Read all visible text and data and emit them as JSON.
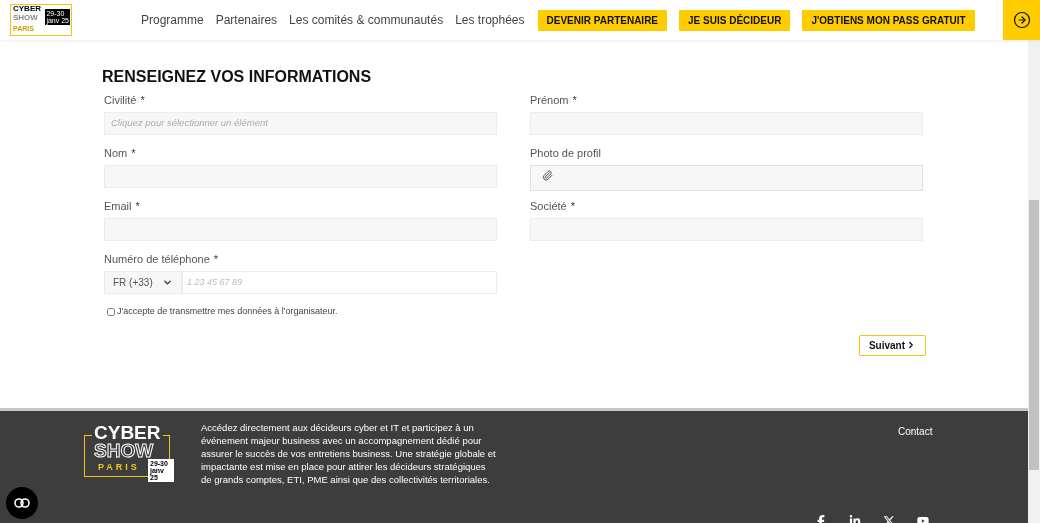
{
  "header": {
    "logo": {
      "words": [
        "CYBER",
        "SHOW",
        "PARIS"
      ],
      "dates": [
        "29-30",
        "janv 25"
      ]
    },
    "nav": [
      "Programme",
      "Partenaires",
      "Les comités & communautés",
      "Les trophées"
    ],
    "buttons": [
      "DEVENIR PARTENAIRE",
      "JE SUIS DÉCIDEUR",
      "J'OBTIENS MON PASS GRATUIT"
    ]
  },
  "form": {
    "title": "RENSEIGNEZ VOS INFORMATIONS",
    "left_fields": [
      {
        "kind": "select",
        "label": "Civilité",
        "required_mark": "*",
        "placeholder": "Cliquez pour sélectionner un élément"
      },
      {
        "kind": "text",
        "label": "Nom",
        "required_mark": "*"
      },
      {
        "kind": "text",
        "label": "Email",
        "required_mark": "*"
      },
      {
        "kind": "phone",
        "label": "Numéro de téléphone",
        "required_mark": "*",
        "country": "FR (+33)",
        "placeholder": "1 23 45 67 89"
      }
    ],
    "right_fields": [
      {
        "kind": "text",
        "label": "Prénom",
        "required_mark": "*"
      },
      {
        "kind": "file",
        "label": "Photo de profil"
      },
      {
        "kind": "text",
        "label": "Société",
        "required_mark": "*"
      }
    ],
    "consent": {
      "label": "J'accepte de transmettre mes données à l'organisateur.",
      "checked": false
    },
    "next_button": "Suivant"
  },
  "footer": {
    "logo": {
      "words": [
        "CYBER",
        "SHOW",
        "PARIS"
      ],
      "dates": [
        "29-30",
        "janv 25"
      ]
    },
    "description": "Accédez directement aux décideurs cyber et IT et participez à un événement majeur business avec un accompagnement dédié pour assurer le succès de vos entretiens business. Une stratégie globale et impactante est mise en place pour attirer les décideurs stratégiques de grands comptes, ETI, PME ainsi que des collectivités territoriales.",
    "contact": "Contact"
  }
}
